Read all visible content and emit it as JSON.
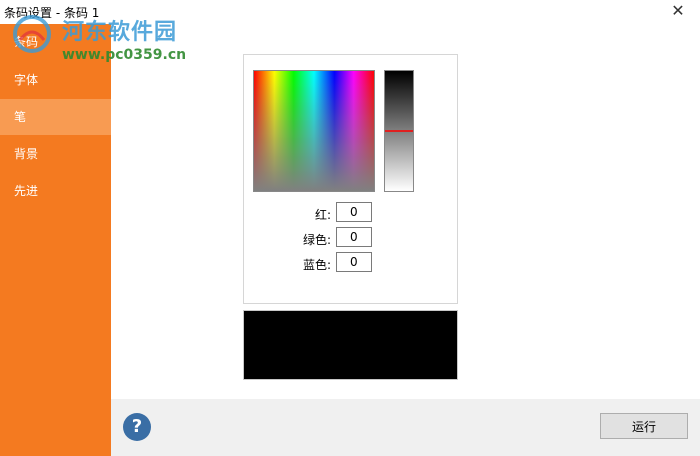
{
  "window": {
    "title": "条码设置 - 条码 1",
    "close_glyph": "✕"
  },
  "watermark": {
    "text": "河东软件园",
    "url": "www.pc0359.cn"
  },
  "sidebar": {
    "items": [
      {
        "label": "条码",
        "selected": false
      },
      {
        "label": "字体",
        "selected": false
      },
      {
        "label": "笔",
        "selected": true
      },
      {
        "label": "背景",
        "selected": false
      },
      {
        "label": "先进",
        "selected": false
      }
    ]
  },
  "color_picker": {
    "luminance_level": 0.5,
    "fields": [
      {
        "label": "红:",
        "value": "0"
      },
      {
        "label": "绿色:",
        "value": "0"
      },
      {
        "label": "蓝色:",
        "value": "0"
      }
    ],
    "preview_color": "#000000"
  },
  "footer": {
    "help_glyph": "?",
    "run_label": "运行"
  },
  "colors": {
    "sidebar": "#f47a20",
    "sidebar_selected": "#f89b52",
    "help": "#3a6ea5"
  },
  "icons": {
    "help": "help-icon",
    "close": "close-icon",
    "logo": "watermark-logo-icon"
  }
}
